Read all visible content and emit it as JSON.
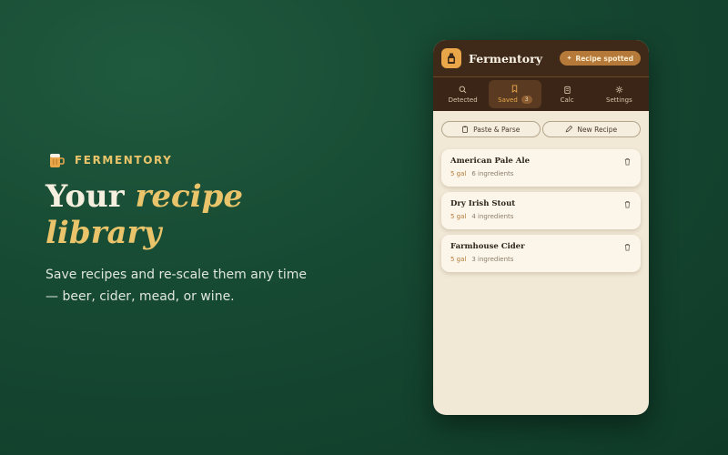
{
  "brand": {
    "name": "FERMENTORY",
    "icon": "beer-mug-icon"
  },
  "headline": {
    "line1_plain": "Your ",
    "line1_accent": "recipe",
    "line2_accent": "library"
  },
  "subtext": "Save recipes and re-scale them any time — beer, cider, mead, or wine.",
  "app": {
    "title": "Fermentory",
    "logo_icon": "jug-icon",
    "spotted_label": "Recipe spotted",
    "tabs": [
      {
        "label": "Detected",
        "icon": "search-icon"
      },
      {
        "label": "Saved",
        "icon": "bookmark-icon",
        "badge": "3"
      },
      {
        "label": "Calc",
        "icon": "clipboard-icon"
      },
      {
        "label": "Settings",
        "icon": "gear-icon"
      }
    ],
    "actions": {
      "paste": "Paste & Parse",
      "new": "New Recipe"
    },
    "recipes": [
      {
        "name": "American Pale Ale",
        "volume": "5 gal",
        "ingredients": "6 ingredients"
      },
      {
        "name": "Dry Irish Stout",
        "volume": "5 gal",
        "ingredients": "4 ingredients"
      },
      {
        "name": "Farmhouse Cider",
        "volume": "5 gal",
        "ingredients": "3 ingredients"
      }
    ]
  },
  "colors": {
    "accent": "#e9c46a",
    "brown": "#3f2a1a",
    "amber": "#b57a39",
    "cream": "#f1e8d6"
  }
}
